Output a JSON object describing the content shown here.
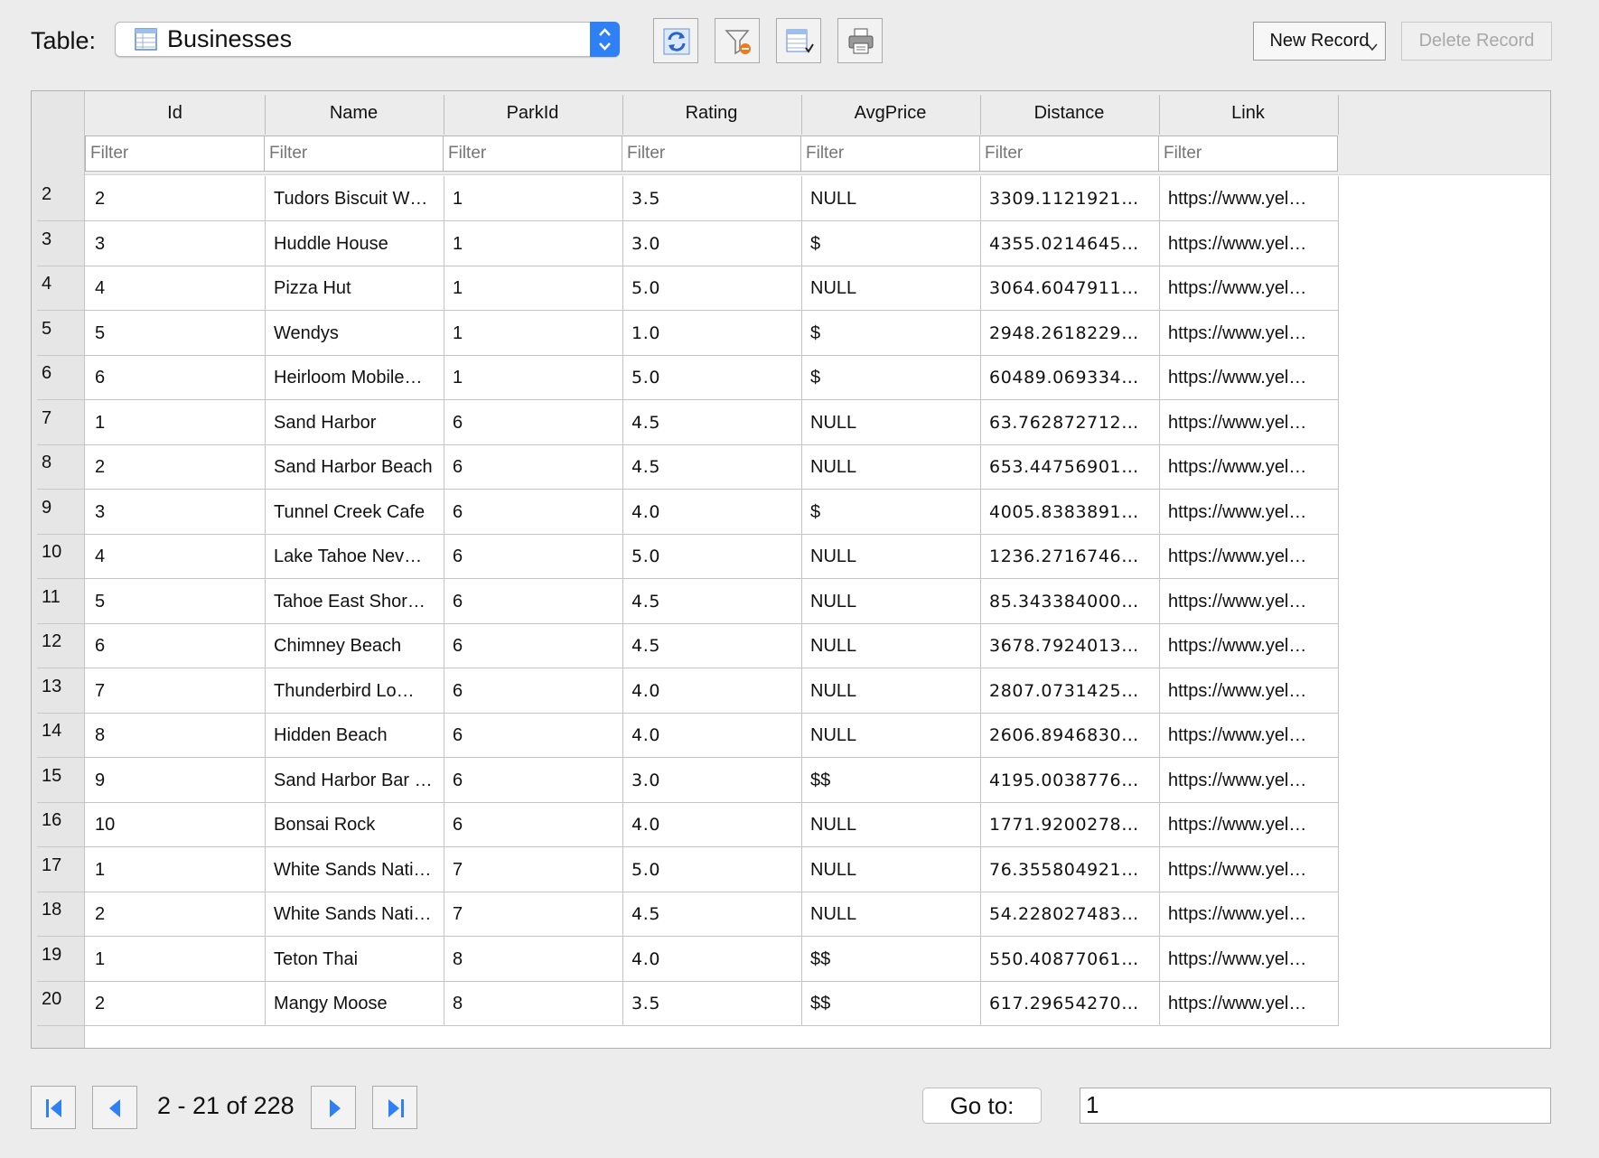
{
  "toolbar": {
    "table_label": "Table:",
    "table_value": "Businesses",
    "new_record": "New Record",
    "delete_record": "Delete Record"
  },
  "columns": [
    "Id",
    "Name",
    "ParkId",
    "Rating",
    "AvgPrice",
    "Distance",
    "Link"
  ],
  "filter_placeholder": "Filter",
  "rows": [
    {
      "n": "2",
      "c": [
        "2",
        "Tudors Biscuit W…",
        "1",
        "3.5",
        "NULL",
        "3309.1121921…",
        "https://www.yel…"
      ]
    },
    {
      "n": "3",
      "c": [
        "3",
        "Huddle House",
        "1",
        "3.0",
        "$",
        "4355.0214645…",
        "https://www.yel…"
      ]
    },
    {
      "n": "4",
      "c": [
        "4",
        "Pizza Hut",
        "1",
        "5.0",
        "NULL",
        "3064.6047911…",
        "https://www.yel…"
      ]
    },
    {
      "n": "5",
      "c": [
        "5",
        "Wendys",
        "1",
        "1.0",
        "$",
        "2948.2618229…",
        "https://www.yel…"
      ]
    },
    {
      "n": "6",
      "c": [
        "6",
        "Heirloom Mobile…",
        "1",
        "5.0",
        "$",
        "60489.069334…",
        "https://www.yel…"
      ]
    },
    {
      "n": "7",
      "c": [
        "1",
        "Sand Harbor",
        "6",
        "4.5",
        "NULL",
        "63.762872712…",
        "https://www.yel…"
      ]
    },
    {
      "n": "8",
      "c": [
        "2",
        "Sand Harbor Beach",
        "6",
        "4.5",
        "NULL",
        "653.44756901…",
        "https://www.yel…"
      ]
    },
    {
      "n": "9",
      "c": [
        "3",
        "Tunnel Creek Cafe",
        "6",
        "4.0",
        "$",
        "4005.8383891…",
        "https://www.yel…"
      ]
    },
    {
      "n": "10",
      "c": [
        "4",
        "Lake Tahoe Nev…",
        "6",
        "5.0",
        "NULL",
        "1236.2716746…",
        "https://www.yel…"
      ]
    },
    {
      "n": "11",
      "c": [
        "5",
        "Tahoe East Shor…",
        "6",
        "4.5",
        "NULL",
        "85.343384000…",
        "https://www.yel…"
      ]
    },
    {
      "n": "12",
      "c": [
        "6",
        "Chimney Beach",
        "6",
        "4.5",
        "NULL",
        "3678.7924013…",
        "https://www.yel…"
      ]
    },
    {
      "n": "13",
      "c": [
        "7",
        "Thunderbird Lo…",
        "6",
        "4.0",
        "NULL",
        "2807.0731425…",
        "https://www.yel…"
      ]
    },
    {
      "n": "14",
      "c": [
        "8",
        "Hidden Beach",
        "6",
        "4.0",
        "NULL",
        "2606.8946830…",
        "https://www.yel…"
      ]
    },
    {
      "n": "15",
      "c": [
        "9",
        "Sand Harbor Bar …",
        "6",
        "3.0",
        "$$",
        "4195.0038776…",
        "https://www.yel…"
      ]
    },
    {
      "n": "16",
      "c": [
        "10",
        "Bonsai Rock",
        "6",
        "4.0",
        "NULL",
        "1771.9200278…",
        "https://www.yel…"
      ]
    },
    {
      "n": "17",
      "c": [
        "1",
        "White Sands Nati…",
        "7",
        "5.0",
        "NULL",
        "76.355804921…",
        "https://www.yel…"
      ]
    },
    {
      "n": "18",
      "c": [
        "2",
        "White Sands Nati…",
        "7",
        "4.5",
        "NULL",
        "54.228027483…",
        "https://www.yel…"
      ]
    },
    {
      "n": "19",
      "c": [
        "1",
        "Teton Thai",
        "8",
        "4.0",
        "$$",
        "550.40877061…",
        "https://www.yel…"
      ]
    },
    {
      "n": "20",
      "c": [
        "2",
        "Mangy Moose",
        "8",
        "3.5",
        "$$",
        "617.29654270…",
        "https://www.yel…"
      ]
    }
  ],
  "footer": {
    "page_info": "2 - 21 of 228",
    "goto_label": "Go to:",
    "goto_value": "1"
  },
  "icons": {
    "table_select": "table-grid-icon",
    "refresh": "refresh-icon",
    "filter": "filter-icon",
    "export": "export-icon",
    "print": "print-icon",
    "first": "first-page-icon",
    "prev": "previous-page-icon",
    "next": "next-page-icon",
    "last": "last-page-icon"
  },
  "colors": {
    "accent": "#2f7ff5",
    "nav_arrow": "#2f7ff5"
  }
}
